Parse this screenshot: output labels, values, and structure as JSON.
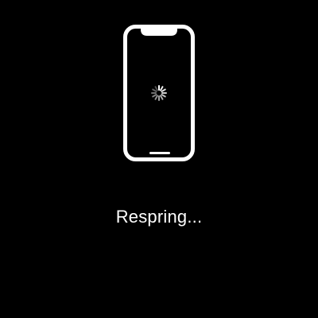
{
  "status": {
    "text": "Respring..."
  },
  "icons": {
    "device": "iphone-outline-icon",
    "spinner": "activity-spinner-icon"
  },
  "colors": {
    "background": "#000000",
    "foreground": "#ffffff"
  }
}
